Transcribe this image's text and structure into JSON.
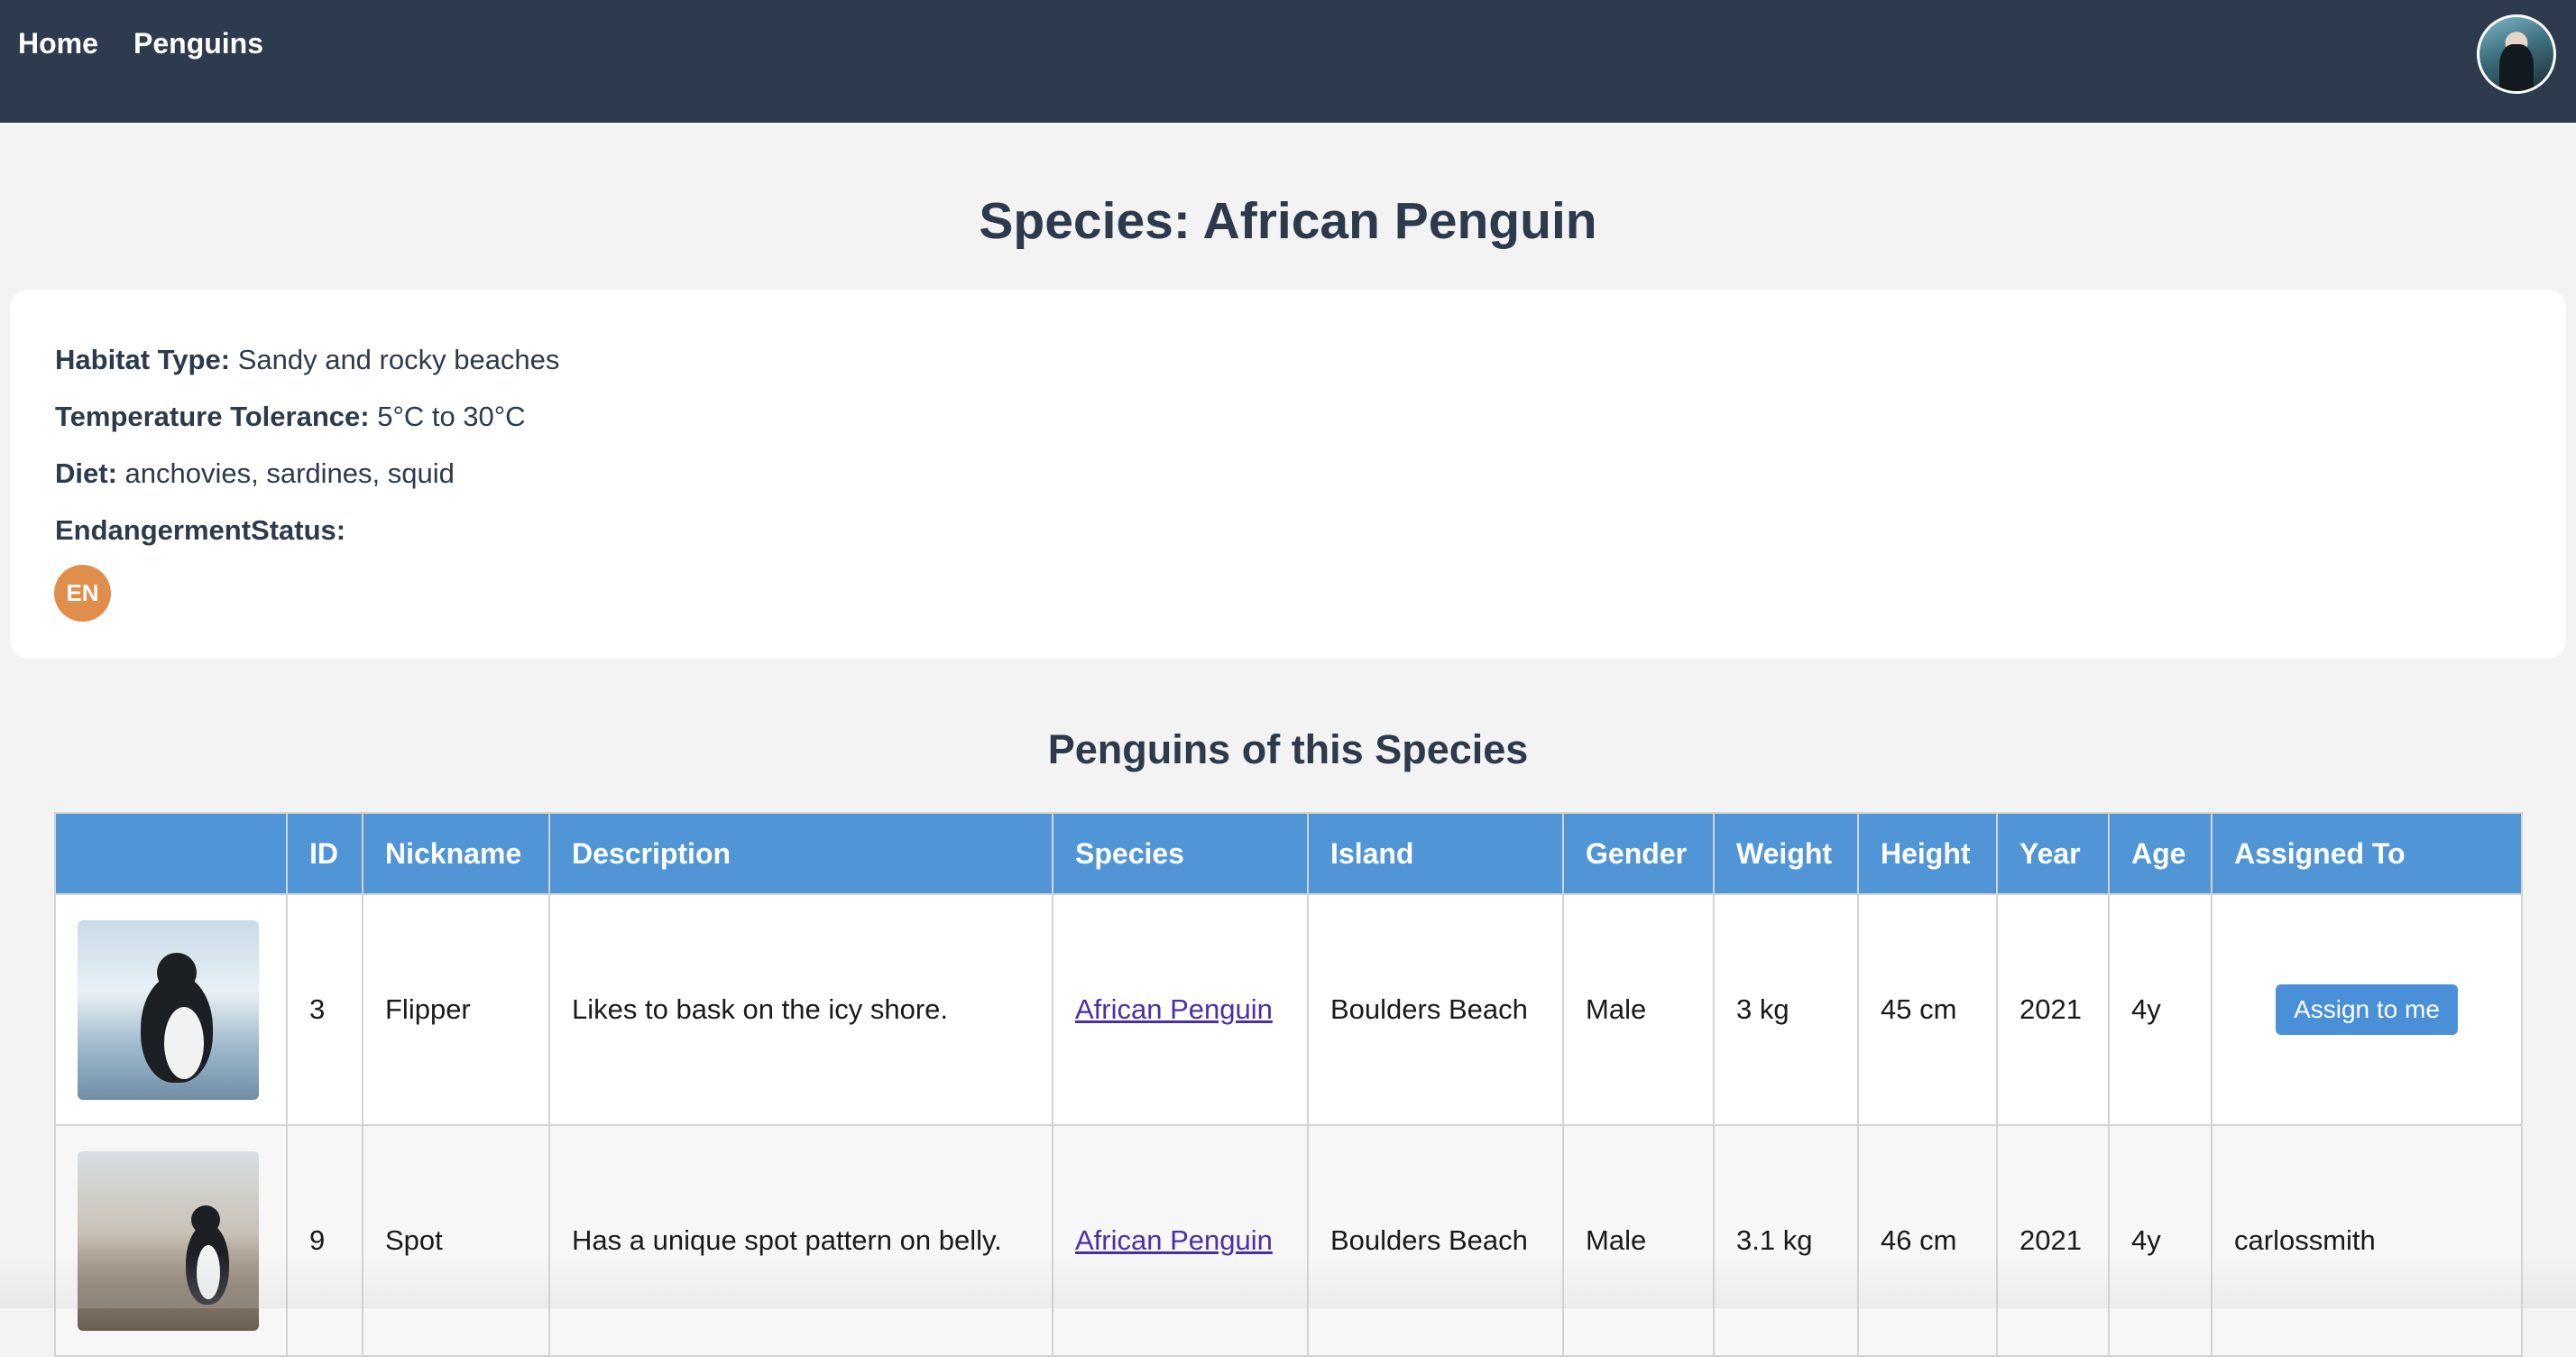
{
  "nav": {
    "home": "Home",
    "penguins": "Penguins"
  },
  "page": {
    "title": "Species: African Penguin"
  },
  "species": {
    "habitat_label": "Habitat Type:",
    "habitat_value": "Sandy and rocky beaches",
    "temp_label": "Temperature Tolerance:",
    "temp_value": "5°C to 30°C",
    "diet_label": "Diet:",
    "diet_value": "anchovies, sardines, squid",
    "status_label": "EndangermentStatus:",
    "status_badge": "EN",
    "status_color": "#e08e4c"
  },
  "section": {
    "title": "Penguins of this Species"
  },
  "table": {
    "headers": [
      "",
      "ID",
      "Nickname",
      "Description",
      "Species",
      "Island",
      "Gender",
      "Weight",
      "Height",
      "Year",
      "Age",
      "Assigned To"
    ],
    "rows": [
      {
        "id": "3",
        "nickname": "Flipper",
        "description": "Likes to bask on the icy shore.",
        "species": "African Penguin",
        "island": "Boulders Beach",
        "gender": "Male",
        "weight": "3 kg",
        "height": "45 cm",
        "year": "2021",
        "age": "4y",
        "assigned": "",
        "assign_button": "Assign to me"
      },
      {
        "id": "9",
        "nickname": "Spot",
        "description": "Has a unique spot pattern on belly.",
        "species": "African Penguin",
        "island": "Boulders Beach",
        "gender": "Male",
        "weight": "3.1 kg",
        "height": "46 cm",
        "year": "2021",
        "age": "4y",
        "assigned": "carlossmith"
      }
    ]
  },
  "colors": {
    "header": "#2e3b4e",
    "table_header": "#5095d6",
    "button": "#4a90d9"
  }
}
